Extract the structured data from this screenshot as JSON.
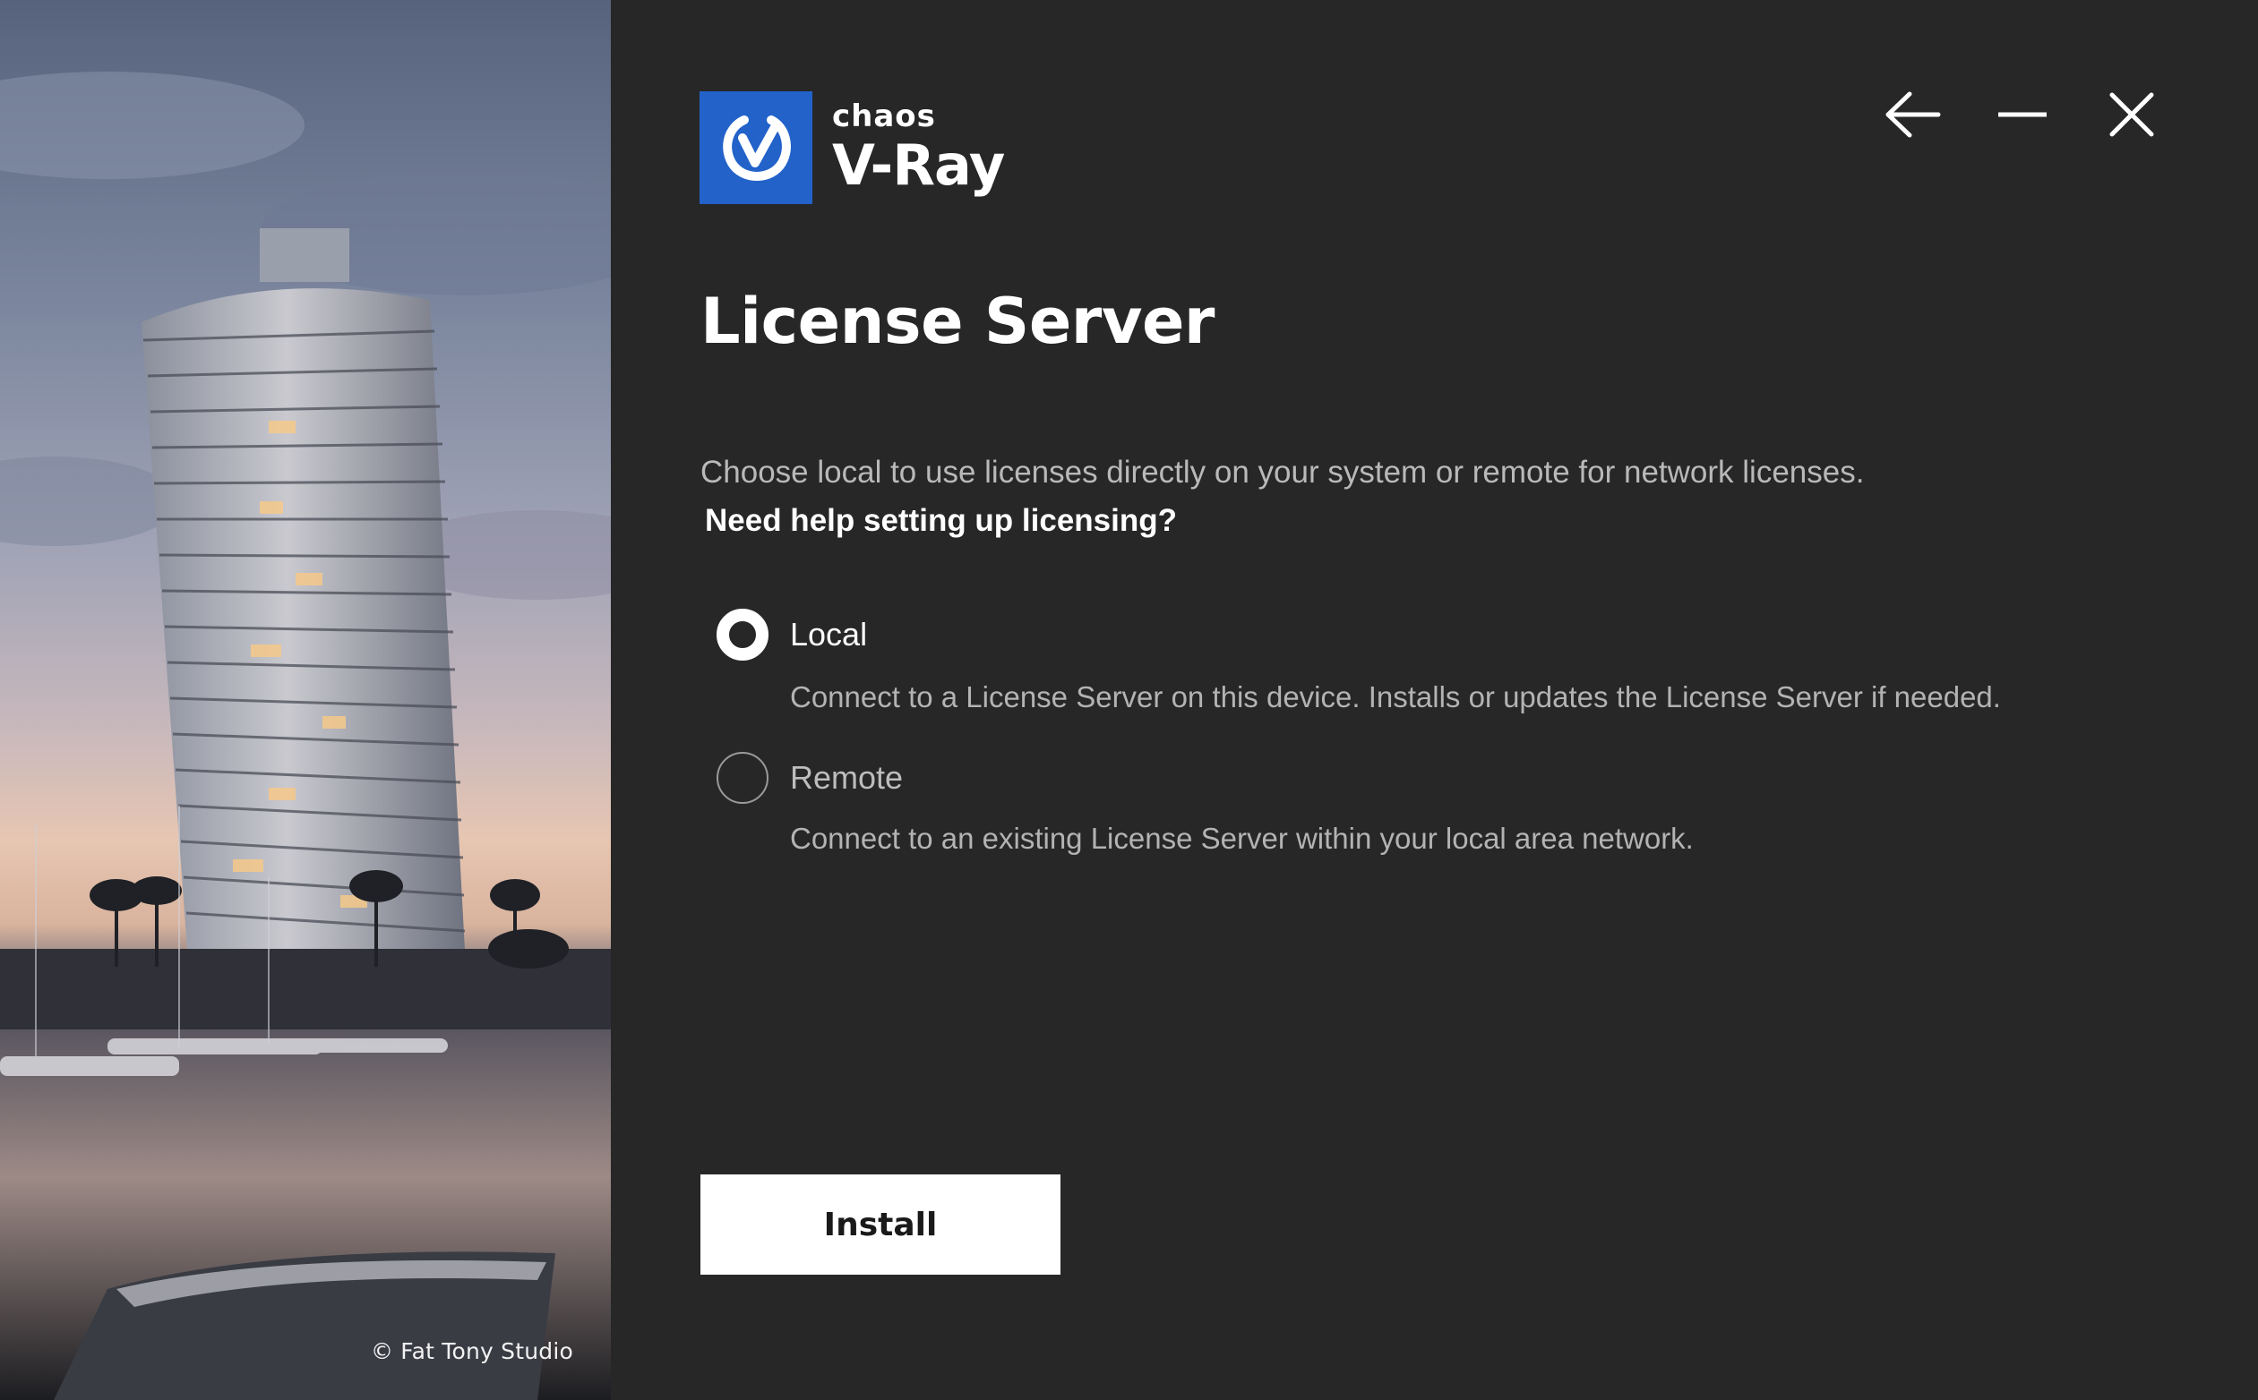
{
  "hero": {
    "credit": "© Fat Tony Studio"
  },
  "logo": {
    "brand": "chaos",
    "product": "V-Ray",
    "mark_color": "#2262c9"
  },
  "window_controls": {
    "back_icon": "arrow-left-icon",
    "minimize_icon": "minimize-icon",
    "close_icon": "close-icon"
  },
  "page": {
    "title": "License Server",
    "description": "Choose local to use licenses directly on your system or remote for network licenses.",
    "help_link": "Need help setting up licensing?"
  },
  "options": {
    "local": {
      "label": "Local",
      "description": "Connect to a License Server on this device. Installs or updates the License Server if needed.",
      "selected": true
    },
    "remote": {
      "label": "Remote",
      "description": "Connect to an existing License Server within your local area network.",
      "selected": false
    }
  },
  "actions": {
    "install_label": "Install"
  },
  "colors": {
    "background": "#272727",
    "accent": "#2262c9",
    "button_bg": "#ffffff"
  }
}
